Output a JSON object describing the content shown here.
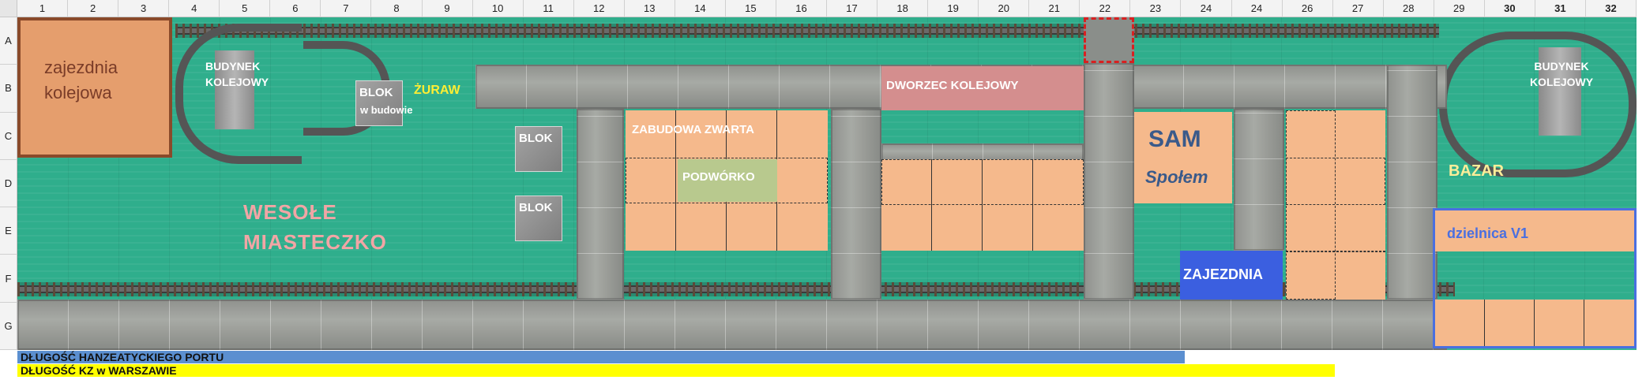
{
  "columns": [
    "1",
    "2",
    "3",
    "4",
    "5",
    "6",
    "7",
    "8",
    "9",
    "10",
    "11",
    "12",
    "13",
    "14",
    "15",
    "16",
    "17",
    "18",
    "19",
    "20",
    "21",
    "22",
    "23",
    "24",
    "24",
    "26",
    "27",
    "28",
    "29",
    "30",
    "31",
    "32"
  ],
  "rows": [
    "A",
    "B",
    "C",
    "D",
    "E",
    "F",
    "G"
  ],
  "labels": {
    "depot": "zajezdnia kolejowa",
    "station_building_left": "BUDYNEK KOLEJOWY",
    "block_in_construction_title": "BLOK",
    "block_in_construction_sub": "w budowie",
    "crane": "ŻURAW",
    "block_1": "BLOK",
    "block_2": "BLOK",
    "amusement_park_line1": "WESOŁE",
    "amusement_park_line2": "MIASTECZKO",
    "dense_buildings": "ZABUDOWA ZWARTA",
    "courtyard": "PODWÓRKO",
    "railway_station": "DWORZEC KOLEJOWY",
    "sam_title": "SAM",
    "sam_sub": "Społem",
    "tram_depot": "ZAJEZDNIA",
    "bazaar": "BAZAR",
    "station_building_right": "BUDYNEK KOLEJOWY",
    "district": "dzielnica V1"
  },
  "legend": {
    "hanseatic_port": "DŁUGOŚĆ HANZEATYCKIEGO PORTU",
    "kz_warsaw": "DŁUGOŚĆ KZ w WARSZAWIE"
  },
  "colors": {
    "grass": "#2fae8c",
    "building_plot": "#f5b98c",
    "depot_fill": "#e59e6d",
    "depot_border": "#8a4a2a",
    "station_fill": "#d48e8e",
    "courtyard_fill": "#b8c98e",
    "tram_depot_fill": "#3b5fe0",
    "district_border": "#4a6fe0",
    "legend_port": "#5b8fd0",
    "legend_kz": "#ffff00",
    "label_white": "#ffffff",
    "label_pink": "#f2a5a5",
    "label_yellow": "#ffee33",
    "sam_text": "#3a5a8a"
  }
}
